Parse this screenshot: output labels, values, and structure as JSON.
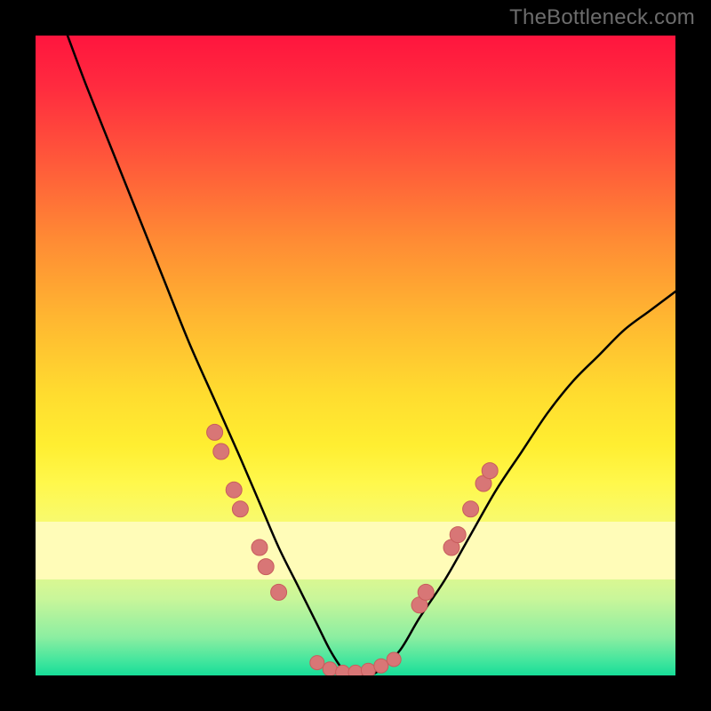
{
  "attribution": "TheBottleneck.com",
  "colors": {
    "frame": "#000000",
    "attribution_text": "#6c6c6c",
    "curve": "#000000",
    "dot_fill": "#d87676",
    "dot_stroke": "#c85d5d",
    "gradient_stops": [
      {
        "pct": 0,
        "hex": "#ff153e"
      },
      {
        "pct": 8,
        "hex": "#ff2b3f"
      },
      {
        "pct": 20,
        "hex": "#ff5a3a"
      },
      {
        "pct": 32,
        "hex": "#ff8b34"
      },
      {
        "pct": 44,
        "hex": "#ffb631"
      },
      {
        "pct": 56,
        "hex": "#ffdc2f"
      },
      {
        "pct": 64,
        "hex": "#ffee31"
      },
      {
        "pct": 70,
        "hex": "#fff84c"
      },
      {
        "pct": 76,
        "hex": "#f8fa6e"
      },
      {
        "pct": 82,
        "hex": "#e9f98a"
      },
      {
        "pct": 88,
        "hex": "#c9f69a"
      },
      {
        "pct": 94,
        "hex": "#8ceea1"
      },
      {
        "pct": 98,
        "hex": "#3de59d"
      },
      {
        "pct": 100,
        "hex": "#17dd98"
      }
    ]
  },
  "chart_data": {
    "type": "line",
    "title": "",
    "xlabel": "",
    "ylabel": "",
    "xlim": [
      0,
      100
    ],
    "ylim": [
      0,
      100
    ],
    "series": [
      {
        "name": "bottleneck-curve",
        "x": [
          5,
          8,
          12,
          16,
          20,
          24,
          28,
          32,
          35,
          38,
          41,
          44,
          46,
          48,
          50,
          52,
          54,
          57,
          60,
          64,
          68,
          72,
          76,
          80,
          84,
          88,
          92,
          96,
          100
        ],
        "y": [
          100,
          92,
          82,
          72,
          62,
          52,
          43,
          34,
          27,
          20,
          14,
          8,
          4,
          1,
          0,
          0,
          1,
          4,
          9,
          15,
          22,
          29,
          35,
          41,
          46,
          50,
          54,
          57,
          60
        ]
      }
    ],
    "marker_points": [
      {
        "name": "left-cluster",
        "points": [
          {
            "x": 28,
            "y": 38
          },
          {
            "x": 29,
            "y": 35
          },
          {
            "x": 31,
            "y": 29
          },
          {
            "x": 32,
            "y": 26
          },
          {
            "x": 35,
            "y": 20
          },
          {
            "x": 36,
            "y": 17
          },
          {
            "x": 38,
            "y": 13
          }
        ]
      },
      {
        "name": "bottom-flat",
        "points": [
          {
            "x": 44,
            "y": 2
          },
          {
            "x": 46,
            "y": 1
          },
          {
            "x": 48,
            "y": 0.5
          },
          {
            "x": 50,
            "y": 0.5
          },
          {
            "x": 52,
            "y": 0.8
          },
          {
            "x": 54,
            "y": 1.5
          },
          {
            "x": 56,
            "y": 2.5
          }
        ]
      },
      {
        "name": "right-cluster",
        "points": [
          {
            "x": 60,
            "y": 11
          },
          {
            "x": 61,
            "y": 13
          },
          {
            "x": 65,
            "y": 20
          },
          {
            "x": 66,
            "y": 22
          },
          {
            "x": 68,
            "y": 26
          },
          {
            "x": 70,
            "y": 30
          },
          {
            "x": 71,
            "y": 32
          }
        ]
      }
    ]
  }
}
